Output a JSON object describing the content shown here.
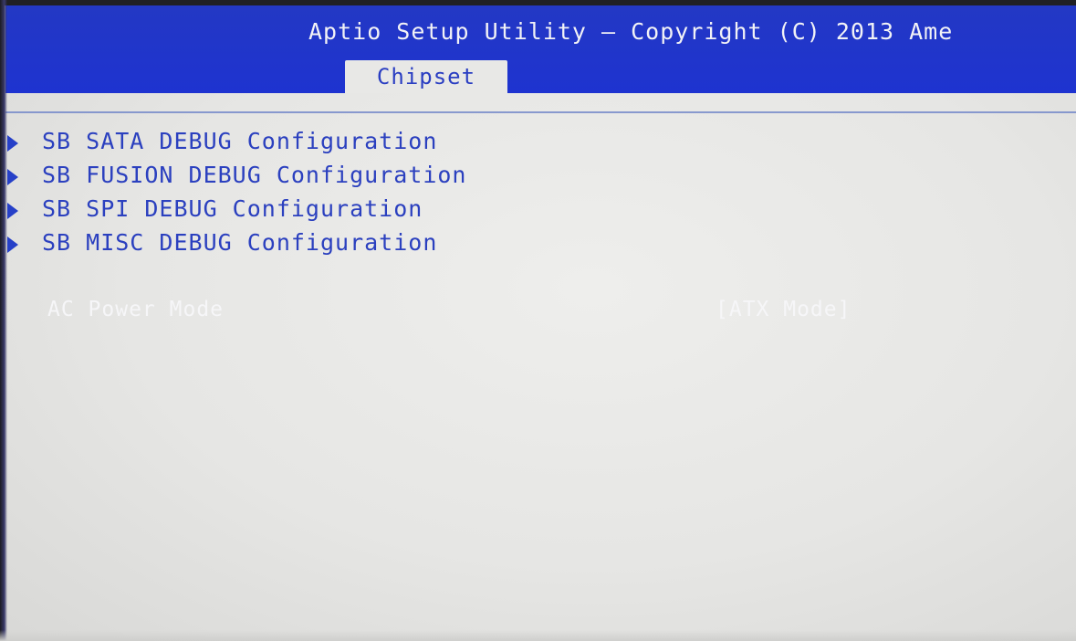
{
  "header": {
    "title": "Aptio Setup Utility – Copyright (C) 2013 Ame",
    "active_tab": "Chipset"
  },
  "menu": {
    "items": [
      {
        "label": "SB SATA DEBUG Configuration",
        "icon": "submenu-arrow-icon"
      },
      {
        "label": "SB FUSION DEBUG Configuration",
        "icon": "submenu-arrow-icon"
      },
      {
        "label": "SB SPI DEBUG Configuration",
        "icon": "submenu-arrow-icon"
      },
      {
        "label": "SB MISC DEBUG Configuration",
        "icon": "submenu-arrow-icon"
      }
    ]
  },
  "settings": {
    "ac_power_mode": {
      "label": "AC Power Mode",
      "value": "[ATX Mode]"
    }
  },
  "colors": {
    "header_blue": "#1f34c8",
    "text_blue": "#2b40bf",
    "background": "#e8e8e6",
    "highlight_text": "#f6f6f8"
  }
}
